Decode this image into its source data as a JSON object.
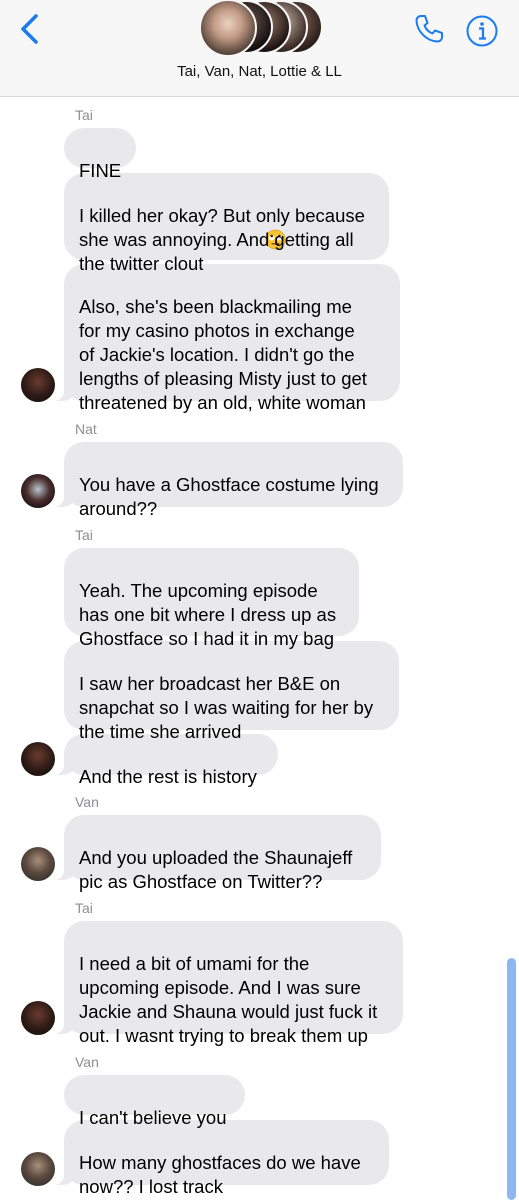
{
  "header": {
    "title": "Tai, Van, Nat, Lottie & LL",
    "back_icon": "chevron-left-icon",
    "phone_icon": "phone-icon",
    "info_icon": "info-icon",
    "accent_color": "#1a7cf0"
  },
  "messages": [
    {
      "sender": "Tai",
      "text": "FINE"
    },
    {
      "text": "I killed her okay? But only because\nshe was annoying. And getting all\nthe twitter clout"
    },
    {
      "text": "Also, she's been blackmailing me\nfor my casino photos in exchange\nof Jackie's location. I didn't go the\nlengths of pleasing Misty just to get\nthreatened by an old, white woman"
    },
    {
      "sender": "Nat",
      "text": "You have a Ghostface costume lying\naround??"
    },
    {
      "sender": "Tai",
      "text": "Yeah. The upcoming episode\nhas one bit where I dress up as\nGhostface so I had it in my bag"
    },
    {
      "text": "I saw her broadcast her B&E on\nsnapchat so I was waiting for her by\nthe time she arrived"
    },
    {
      "text": "And the rest is history"
    },
    {
      "sender": "Van",
      "text": "And you uploaded the Shaunajeff\npic as Ghostface on Twitter??"
    },
    {
      "sender": "Tai",
      "text": "I need a bit of umami for the\nupcoming episode. And I was sure\nJackie and Shauna would just fuck it\nout. I wasnt trying to break them up"
    },
    {
      "sender": "Van",
      "text": "I can't believe you"
    },
    {
      "text": "How many ghostfaces do we have\nnow?? I lost track"
    }
  ]
}
